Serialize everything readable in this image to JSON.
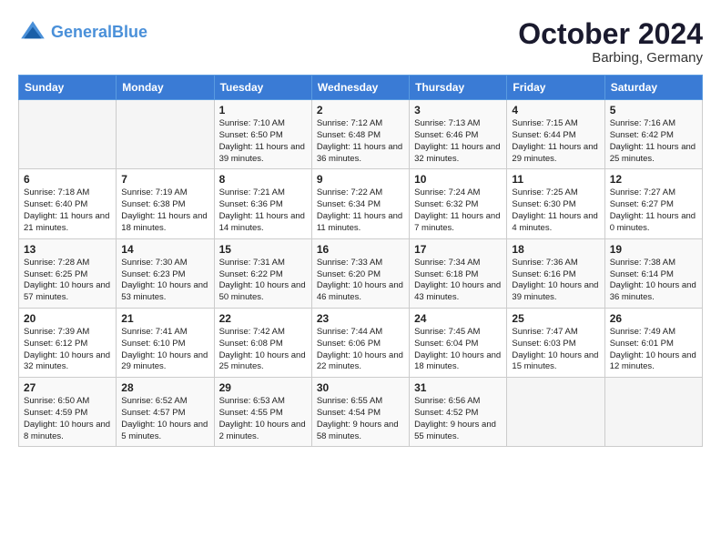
{
  "header": {
    "logo_line1": "General",
    "logo_line2": "Blue",
    "month": "October 2024",
    "location": "Barbing, Germany"
  },
  "weekdays": [
    "Sunday",
    "Monday",
    "Tuesday",
    "Wednesday",
    "Thursday",
    "Friday",
    "Saturday"
  ],
  "weeks": [
    [
      {
        "day": "",
        "content": ""
      },
      {
        "day": "",
        "content": ""
      },
      {
        "day": "1",
        "content": "Sunrise: 7:10 AM\nSunset: 6:50 PM\nDaylight: 11 hours and 39 minutes."
      },
      {
        "day": "2",
        "content": "Sunrise: 7:12 AM\nSunset: 6:48 PM\nDaylight: 11 hours and 36 minutes."
      },
      {
        "day": "3",
        "content": "Sunrise: 7:13 AM\nSunset: 6:46 PM\nDaylight: 11 hours and 32 minutes."
      },
      {
        "day": "4",
        "content": "Sunrise: 7:15 AM\nSunset: 6:44 PM\nDaylight: 11 hours and 29 minutes."
      },
      {
        "day": "5",
        "content": "Sunrise: 7:16 AM\nSunset: 6:42 PM\nDaylight: 11 hours and 25 minutes."
      }
    ],
    [
      {
        "day": "6",
        "content": "Sunrise: 7:18 AM\nSunset: 6:40 PM\nDaylight: 11 hours and 21 minutes."
      },
      {
        "day": "7",
        "content": "Sunrise: 7:19 AM\nSunset: 6:38 PM\nDaylight: 11 hours and 18 minutes."
      },
      {
        "day": "8",
        "content": "Sunrise: 7:21 AM\nSunset: 6:36 PM\nDaylight: 11 hours and 14 minutes."
      },
      {
        "day": "9",
        "content": "Sunrise: 7:22 AM\nSunset: 6:34 PM\nDaylight: 11 hours and 11 minutes."
      },
      {
        "day": "10",
        "content": "Sunrise: 7:24 AM\nSunset: 6:32 PM\nDaylight: 11 hours and 7 minutes."
      },
      {
        "day": "11",
        "content": "Sunrise: 7:25 AM\nSunset: 6:30 PM\nDaylight: 11 hours and 4 minutes."
      },
      {
        "day": "12",
        "content": "Sunrise: 7:27 AM\nSunset: 6:27 PM\nDaylight: 11 hours and 0 minutes."
      }
    ],
    [
      {
        "day": "13",
        "content": "Sunrise: 7:28 AM\nSunset: 6:25 PM\nDaylight: 10 hours and 57 minutes."
      },
      {
        "day": "14",
        "content": "Sunrise: 7:30 AM\nSunset: 6:23 PM\nDaylight: 10 hours and 53 minutes."
      },
      {
        "day": "15",
        "content": "Sunrise: 7:31 AM\nSunset: 6:22 PM\nDaylight: 10 hours and 50 minutes."
      },
      {
        "day": "16",
        "content": "Sunrise: 7:33 AM\nSunset: 6:20 PM\nDaylight: 10 hours and 46 minutes."
      },
      {
        "day": "17",
        "content": "Sunrise: 7:34 AM\nSunset: 6:18 PM\nDaylight: 10 hours and 43 minutes."
      },
      {
        "day": "18",
        "content": "Sunrise: 7:36 AM\nSunset: 6:16 PM\nDaylight: 10 hours and 39 minutes."
      },
      {
        "day": "19",
        "content": "Sunrise: 7:38 AM\nSunset: 6:14 PM\nDaylight: 10 hours and 36 minutes."
      }
    ],
    [
      {
        "day": "20",
        "content": "Sunrise: 7:39 AM\nSunset: 6:12 PM\nDaylight: 10 hours and 32 minutes."
      },
      {
        "day": "21",
        "content": "Sunrise: 7:41 AM\nSunset: 6:10 PM\nDaylight: 10 hours and 29 minutes."
      },
      {
        "day": "22",
        "content": "Sunrise: 7:42 AM\nSunset: 6:08 PM\nDaylight: 10 hours and 25 minutes."
      },
      {
        "day": "23",
        "content": "Sunrise: 7:44 AM\nSunset: 6:06 PM\nDaylight: 10 hours and 22 minutes."
      },
      {
        "day": "24",
        "content": "Sunrise: 7:45 AM\nSunset: 6:04 PM\nDaylight: 10 hours and 18 minutes."
      },
      {
        "day": "25",
        "content": "Sunrise: 7:47 AM\nSunset: 6:03 PM\nDaylight: 10 hours and 15 minutes."
      },
      {
        "day": "26",
        "content": "Sunrise: 7:49 AM\nSunset: 6:01 PM\nDaylight: 10 hours and 12 minutes."
      }
    ],
    [
      {
        "day": "27",
        "content": "Sunrise: 6:50 AM\nSunset: 4:59 PM\nDaylight: 10 hours and 8 minutes."
      },
      {
        "day": "28",
        "content": "Sunrise: 6:52 AM\nSunset: 4:57 PM\nDaylight: 10 hours and 5 minutes."
      },
      {
        "day": "29",
        "content": "Sunrise: 6:53 AM\nSunset: 4:55 PM\nDaylight: 10 hours and 2 minutes."
      },
      {
        "day": "30",
        "content": "Sunrise: 6:55 AM\nSunset: 4:54 PM\nDaylight: 9 hours and 58 minutes."
      },
      {
        "day": "31",
        "content": "Sunrise: 6:56 AM\nSunset: 4:52 PM\nDaylight: 9 hours and 55 minutes."
      },
      {
        "day": "",
        "content": ""
      },
      {
        "day": "",
        "content": ""
      }
    ]
  ]
}
